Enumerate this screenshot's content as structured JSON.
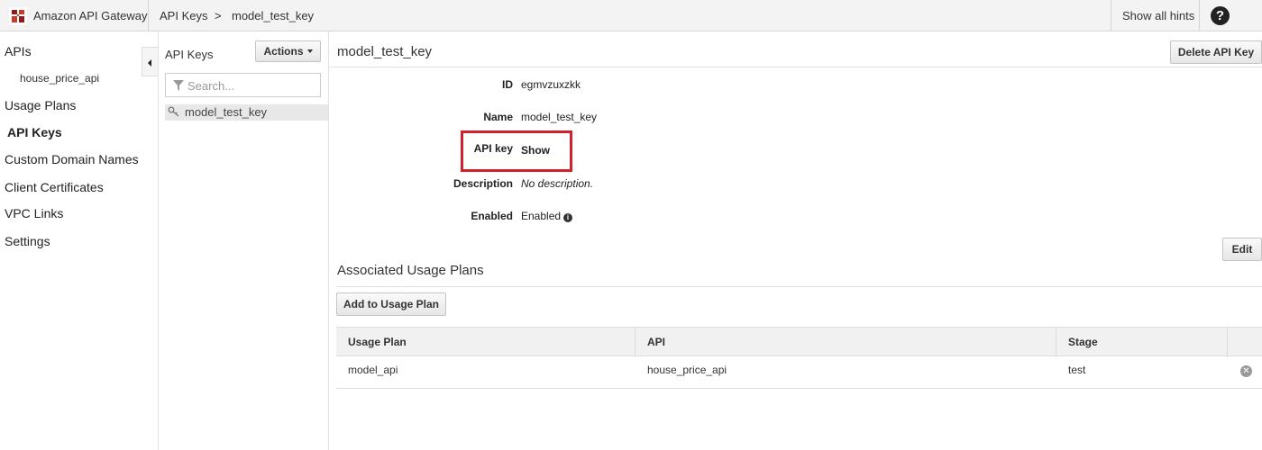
{
  "topbar": {
    "app_title": "Amazon API Gateway",
    "breadcrumb": [
      "API Keys",
      ">",
      "model_test_key"
    ],
    "hints_label": "Show all hints",
    "help_label": "?"
  },
  "sidebar": {
    "items": [
      {
        "label": "APIs"
      },
      {
        "label": "house_price_api"
      },
      {
        "label": "Usage Plans"
      },
      {
        "label": "API Keys"
      },
      {
        "label": "Custom Domain Names"
      },
      {
        "label": "Client Certificates"
      },
      {
        "label": "VPC Links"
      },
      {
        "label": "Settings"
      }
    ],
    "active": "API Keys"
  },
  "keys_panel": {
    "title": "API Keys",
    "actions_label": "Actions",
    "search_placeholder": "Search...",
    "keys": [
      "model_test_key"
    ]
  },
  "detail": {
    "title": "model_test_key",
    "delete_label": "Delete API Key",
    "fields": [
      {
        "label": "ID",
        "value": "egmvzuxzkk"
      },
      {
        "label": "Name",
        "value": "model_test_key"
      },
      {
        "label": "API key",
        "value": "Show"
      },
      {
        "label": "Description",
        "value": "No description."
      },
      {
        "label": "Enabled",
        "value": "Enabled"
      }
    ],
    "edit_label": "Edit",
    "usage_section_title": "Associated Usage Plans",
    "add_usage_label": "Add to Usage Plan",
    "table": {
      "columns": [
        "Usage Plan",
        "API",
        "Stage"
      ],
      "rows": [
        {
          "usage_plan": "model_api",
          "api": "house_price_api",
          "stage": "test"
        }
      ]
    }
  },
  "colors": {
    "highlight": "#d0222b",
    "topbar_bg": "#f3f3f3"
  }
}
